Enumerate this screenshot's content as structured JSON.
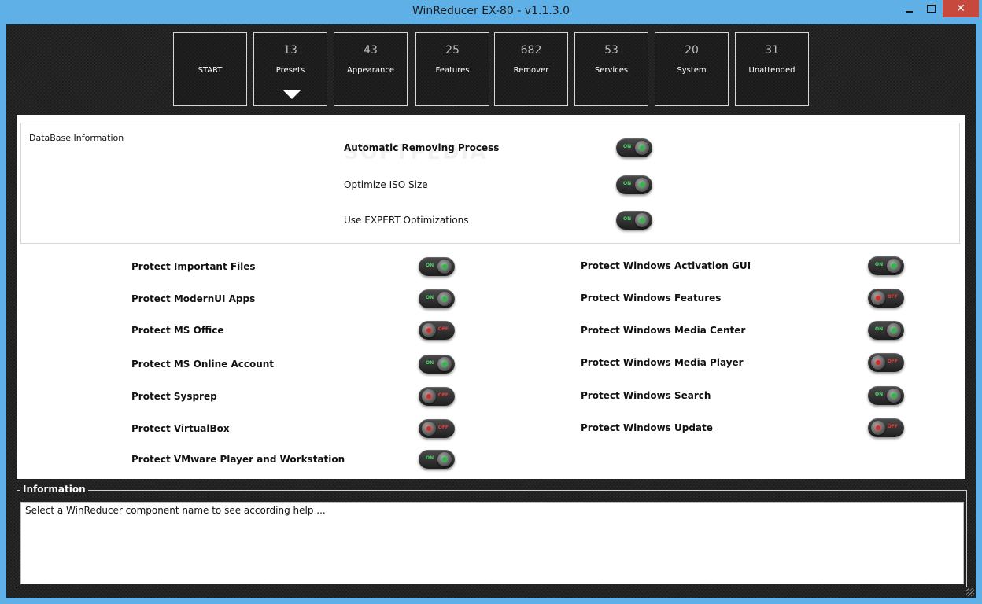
{
  "window": {
    "title": "WinReducer EX-80 - v1.1.3.0",
    "controls": {
      "close": "✕"
    }
  },
  "tabs": [
    {
      "key": "start",
      "count": "",
      "label": "START"
    },
    {
      "key": "presets",
      "count": "13",
      "label": "Presets",
      "active": true
    },
    {
      "key": "appearance",
      "count": "43",
      "label": "Appearance"
    },
    {
      "key": "features",
      "count": "25",
      "label": "Features"
    },
    {
      "key": "remover",
      "count": "682",
      "label": "Remover"
    },
    {
      "key": "services",
      "count": "53",
      "label": "Services"
    },
    {
      "key": "system",
      "count": "20",
      "label": "System"
    },
    {
      "key": "unattended",
      "count": "31",
      "label": "Unattended"
    }
  ],
  "database": {
    "link": "DataBase Information",
    "watermark": "SOFTPEDIA",
    "options": [
      {
        "label": "Automatic Removing Process",
        "state": "on",
        "toggle_text": "ON"
      },
      {
        "label": "Optimize ISO Size",
        "state": "on",
        "toggle_text": "ON"
      },
      {
        "label": "Use EXPERT Optimizations",
        "state": "on",
        "toggle_text": "ON"
      }
    ]
  },
  "protect_left": [
    {
      "label": "Protect Important Files",
      "state": "on",
      "toggle_text": "ON"
    },
    {
      "label": "Protect ModernUI Apps",
      "state": "on",
      "toggle_text": "ON"
    },
    {
      "label": "Protect MS Office",
      "state": "off",
      "toggle_text": "OFF"
    },
    {
      "label": "Protect MS Online Account",
      "state": "on",
      "toggle_text": "ON"
    },
    {
      "label": "Protect Sysprep",
      "state": "off",
      "toggle_text": "OFF"
    },
    {
      "label": "Protect VirtualBox",
      "state": "off",
      "toggle_text": "OFF"
    },
    {
      "label": "Protect VMware Player and Workstation",
      "state": "on",
      "toggle_text": "ON"
    }
  ],
  "protect_right": [
    {
      "label": "Protect Windows Activation GUI",
      "state": "on",
      "toggle_text": "ON"
    },
    {
      "label": "Protect Windows Features",
      "state": "off",
      "toggle_text": "OFF"
    },
    {
      "label": "Protect Windows Media Center",
      "state": "on",
      "toggle_text": "ON"
    },
    {
      "label": "Protect Windows Media Player",
      "state": "off",
      "toggle_text": "OFF"
    },
    {
      "label": "Protect Windows Search",
      "state": "on",
      "toggle_text": "ON"
    },
    {
      "label": "Protect Windows Update",
      "state": "off",
      "toggle_text": "OFF"
    }
  ],
  "information": {
    "title": "Information",
    "text": "Select a WinReducer component name to see according help ..."
  }
}
